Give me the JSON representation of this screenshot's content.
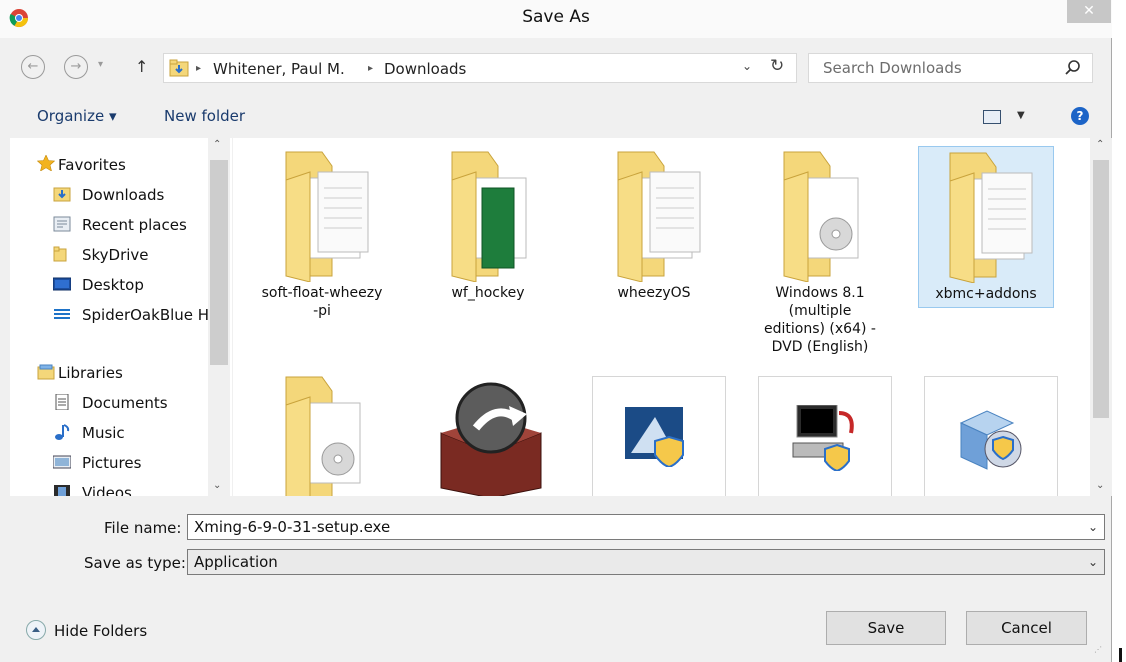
{
  "window": {
    "title": "Save As",
    "close_glyph": "✕"
  },
  "icons": {
    "app": "chrome-icon",
    "back": "back-arrow-icon",
    "forward": "forward-arrow-icon",
    "up": "up-arrow-icon",
    "refresh": "refresh-icon",
    "search": "search-icon",
    "help": "help-icon",
    "view": "view-options-icon"
  },
  "address": {
    "crumbs": [
      "Whitener, Paul M.",
      "Downloads"
    ],
    "sep": "▸",
    "search_placeholder": "Search Downloads"
  },
  "toolbar": {
    "organize": "Organize ▾",
    "new_folder": "New folder",
    "help": "?"
  },
  "nav": {
    "favorites": {
      "label": "Favorites",
      "items": [
        "Downloads",
        "Recent places",
        "SkyDrive",
        "Desktop",
        "SpiderOakBlue H"
      ]
    },
    "libraries": {
      "label": "Libraries",
      "items": [
        "Documents",
        "Music",
        "Pictures",
        "Videos"
      ]
    }
  },
  "files": [
    {
      "name": "soft-float-wheezy\n-pi",
      "kind": "folder-docs"
    },
    {
      "name": "wf_hockey",
      "kind": "folder-green"
    },
    {
      "name": "wheezyOS",
      "kind": "folder-docs"
    },
    {
      "name": "Windows 8.1\n(multiple\neditions) (x64) -\nDVD (English)",
      "kind": "folder-disc"
    },
    {
      "name": "xbmc+addons",
      "kind": "folder-docs",
      "selected": true
    },
    {
      "name": "",
      "kind": "folder-disc"
    },
    {
      "name": "",
      "kind": "app-box"
    },
    {
      "name": "",
      "kind": "app-shield-triangle"
    },
    {
      "name": "",
      "kind": "app-computer"
    },
    {
      "name": "",
      "kind": "app-installer"
    }
  ],
  "form": {
    "filename_label": "File name:",
    "filename_value": "Xming-6-9-0-31-setup.exe",
    "type_label": "Save as type:",
    "type_value": "Application"
  },
  "footer": {
    "hide_folders": "Hide Folders",
    "save": "Save",
    "cancel": "Cancel"
  },
  "colors": {
    "accent": "#1a3b6d",
    "selected_bg": "#d9ebf9",
    "selected_border": "#99c9ef",
    "folder": "#f4d77a"
  }
}
